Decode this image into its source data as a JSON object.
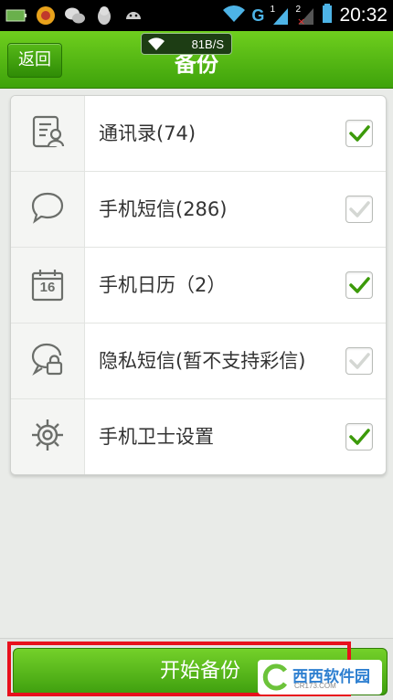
{
  "status_bar": {
    "time": "20:32",
    "network": "G",
    "sim1": "1",
    "sim2": "2"
  },
  "header": {
    "back_label": "返回",
    "title": "备份",
    "speed": "81B/S"
  },
  "items": [
    {
      "label": "通讯录(74)",
      "icon": "contacts-icon",
      "checked": true
    },
    {
      "label": "手机短信(286)",
      "icon": "sms-icon",
      "checked": false
    },
    {
      "label": "手机日历（2）",
      "icon": "calendar-icon",
      "checked": true
    },
    {
      "label": "隐私短信(暂不支持彩信)",
      "icon": "private-sms-icon",
      "checked": false
    },
    {
      "label": "手机卫士设置",
      "icon": "settings-gear-icon",
      "checked": true
    }
  ],
  "calendar_day": "16",
  "action": {
    "start_label": "开始备份"
  },
  "watermark": {
    "text": "西西软件园",
    "sub": "CR173.COM"
  },
  "colors": {
    "accent": "#4caf14",
    "check_active": "#3c9a0a",
    "check_inactive": "#c9ccc8",
    "highlight_frame": "#e8101c"
  }
}
